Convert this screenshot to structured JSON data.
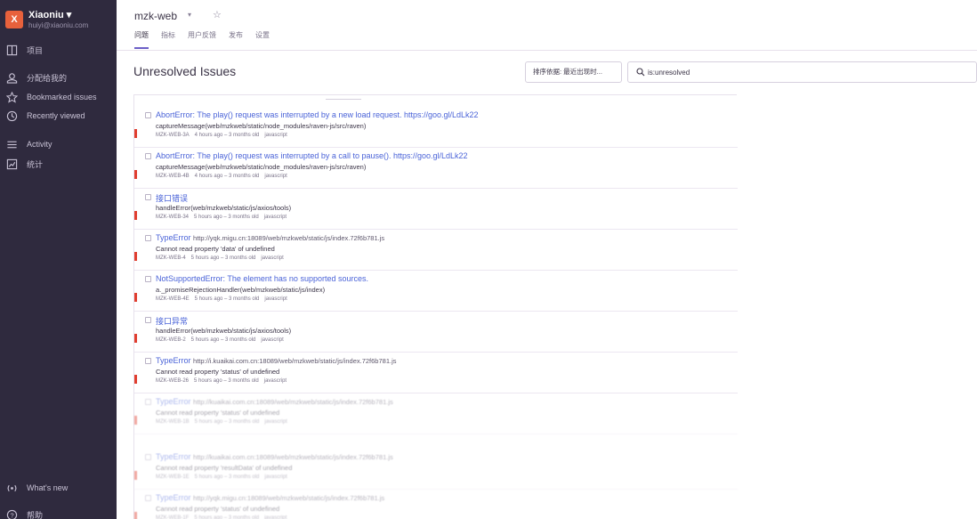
{
  "sidebar": {
    "org_initial": "X",
    "org_name": "Xiaoniu ▾",
    "org_user": "huiyi@xiaoniu.com",
    "items": [
      {
        "label": "项目",
        "icon": "projects-icon"
      },
      {
        "label": "分配给我的",
        "icon": "user-icon"
      },
      {
        "label": "Bookmarked issues",
        "icon": "star-icon"
      },
      {
        "label": "Recently viewed",
        "icon": "clock-icon"
      },
      {
        "label": "Activity",
        "icon": "list-icon"
      },
      {
        "label": "统计",
        "icon": "chart-icon"
      }
    ],
    "whats_new": "What's new",
    "help": "帮助"
  },
  "header": {
    "project": "mzk-web",
    "tabs": [
      "问题",
      "指标",
      "用户反馈",
      "发布",
      "设置"
    ]
  },
  "page_title": "Unresolved Issues",
  "sort_label": "排序依据: 最近出现时...",
  "search": {
    "value": "is:unresolved"
  },
  "issues": [
    {
      "type": "AbortError:",
      "message": "The play() request was interrupted by a new load request. https://goo.gl/LdLk22",
      "url": "",
      "culprit": "captureMessage(web/mzkweb/static/node_modules/raven-js/src/raven)",
      "id": "MZK-WEB-3A",
      "time": "4 hours ago – 3 months old",
      "platform": "javascript",
      "faded": false
    },
    {
      "type": "AbortError:",
      "message": "The play() request was interrupted by a call to pause(). https://goo.gl/LdLk22",
      "url": "",
      "culprit": "captureMessage(web/mzkweb/static/node_modules/raven-js/src/raven)",
      "id": "MZK-WEB-4B",
      "time": "4 hours ago – 3 months old",
      "platform": "javascript",
      "faded": false
    },
    {
      "type": "接口错误",
      "message": "",
      "url": "",
      "culprit": "handleError(web/mzkweb/static/js/axios/tools)",
      "id": "MZK-WEB-34",
      "time": "5 hours ago – 3 months old",
      "platform": "javascript",
      "faded": false
    },
    {
      "type": "TypeError",
      "message": "",
      "url": "http://yqk.migu.cn:18089/web/mzkweb/static/js/index.72f6b781.js",
      "culprit": "Cannot read property 'data' of undefined",
      "id": "MZK-WEB-4",
      "time": "5 hours ago – 3 months old",
      "platform": "javascript",
      "faded": false
    },
    {
      "type": "NotSupportedError:",
      "message": "The element has no supported sources.",
      "url": "",
      "culprit": "a._promiseRejectionHandler(web/mzkweb/static/js/index)",
      "id": "MZK-WEB-4E",
      "time": "5 hours ago – 3 months old",
      "platform": "javascript",
      "faded": false
    },
    {
      "type": "接口异常",
      "message": "",
      "url": "",
      "culprit": "handleError(web/mzkweb/static/js/axios/tools)",
      "id": "MZK-WEB-2",
      "time": "5 hours ago – 3 months old",
      "platform": "javascript",
      "faded": false
    },
    {
      "type": "TypeError",
      "message": "",
      "url": "http://i.kuaikai.com.cn:18089/web/mzkweb/static/js/index.72f6b781.js",
      "culprit": "Cannot read property 'status' of undefined",
      "id": "MZK-WEB-26",
      "time": "5 hours ago – 3 months old",
      "platform": "javascript",
      "faded": false
    },
    {
      "type": "TypeError",
      "message": "",
      "url": "http://kuaikai.com.cn:18089/web/mzkweb/static/js/index.72f6b781.js",
      "culprit": "Cannot read property 'status' of undefined",
      "id": "MZK-WEB-1B",
      "time": "5 hours ago – 3 months old",
      "platform": "javascript",
      "faded": true
    },
    {
      "type": "TypeError",
      "message": "",
      "url": "http://kuaikai.com.cn:18089/web/mzkweb/static/js/index.72f6b781.js",
      "culprit": "Cannot read property 'resultData' of undefined",
      "id": "MZK-WEB-1E",
      "time": "5 hours ago – 3 months old",
      "platform": "javascript",
      "faded": true
    },
    {
      "type": "TypeError",
      "message": "",
      "url": "http://yqk.migu.cn:18089/web/mzkweb/static/js/index.72f6b781.js",
      "culprit": "Cannot read property 'status' of undefined",
      "id": "MZK-WEB-1F",
      "time": "5 hours ago – 3 months old",
      "platform": "javascript",
      "faded": true
    }
  ],
  "colors": {
    "sidebar": "#2f2a3e",
    "accent": "#6c5fc7",
    "link": "#4a63d8",
    "error_level": "#e03e2f",
    "org_avatar": "#e8613c"
  }
}
